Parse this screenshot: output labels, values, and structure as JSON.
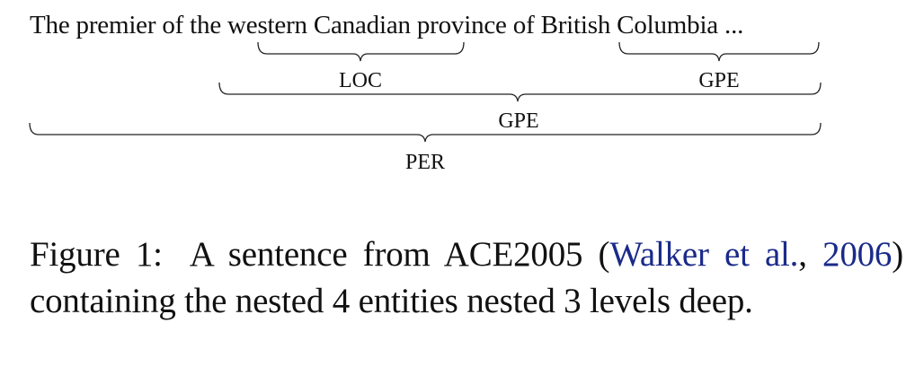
{
  "sentence": {
    "tokens": [
      "The premier of the ",
      "western Canadian",
      " province of ",
      "British Columbia",
      " ..."
    ]
  },
  "entities": [
    {
      "label": "LOC",
      "span": "western Canadian",
      "level": 1
    },
    {
      "label": "GPE",
      "span": "British Columbia",
      "level": 1
    },
    {
      "label": "GPE",
      "span": "western Canadian province of British Columbia",
      "level": 2
    },
    {
      "label": "PER",
      "span": "The premier of the western Canadian province of British Columbia",
      "level": 3
    }
  ],
  "caption": {
    "figure_label": "Figure 1:",
    "text_before": "A sentence from ACE2005 (",
    "citation_authors": "Walker et al.",
    "citation_sep": ", ",
    "citation_year": "2006",
    "text_after": ") containing the nested 4 entities nested 3 levels deep."
  },
  "colors": {
    "text": "#111111",
    "citation": "#1a2a8a"
  }
}
